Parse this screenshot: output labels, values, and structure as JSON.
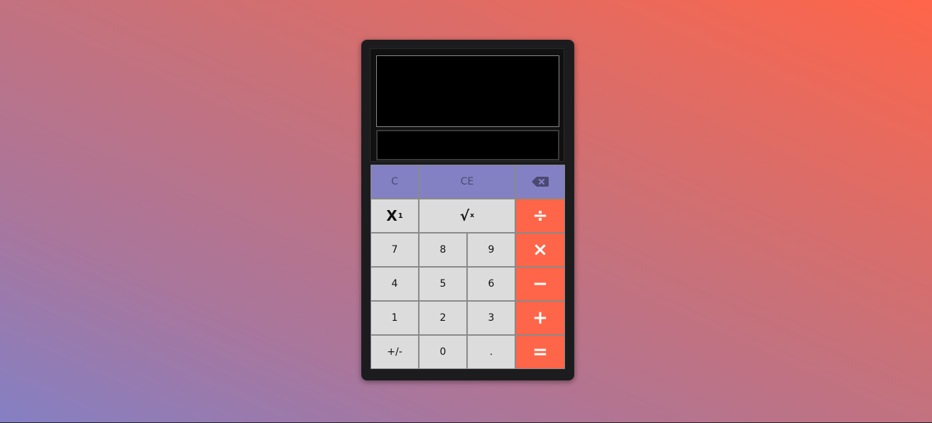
{
  "display": {
    "expression": "",
    "result": ""
  },
  "keys": {
    "clear": "C",
    "clear_entry": "CE",
    "backspace_icon": "backspace-icon",
    "power_base": "X",
    "power_exp": "1",
    "sqrt_symbol": "√",
    "sqrt_x": "x",
    "divide": "÷",
    "multiply": "×",
    "subtract": "−",
    "add": "+",
    "equals": "=",
    "seven": "7",
    "eight": "8",
    "nine": "9",
    "four": "4",
    "five": "5",
    "six": "6",
    "one": "1",
    "two": "2",
    "three": "3",
    "negate": "+/-",
    "zero": "0",
    "decimal": "."
  },
  "colors": {
    "background_start": "#8480c4",
    "background_end": "#ff6549",
    "top_row": "#8480c4",
    "operator": "#ff6549",
    "digit": "#dcdcdc",
    "body": "#1c1c1e"
  }
}
